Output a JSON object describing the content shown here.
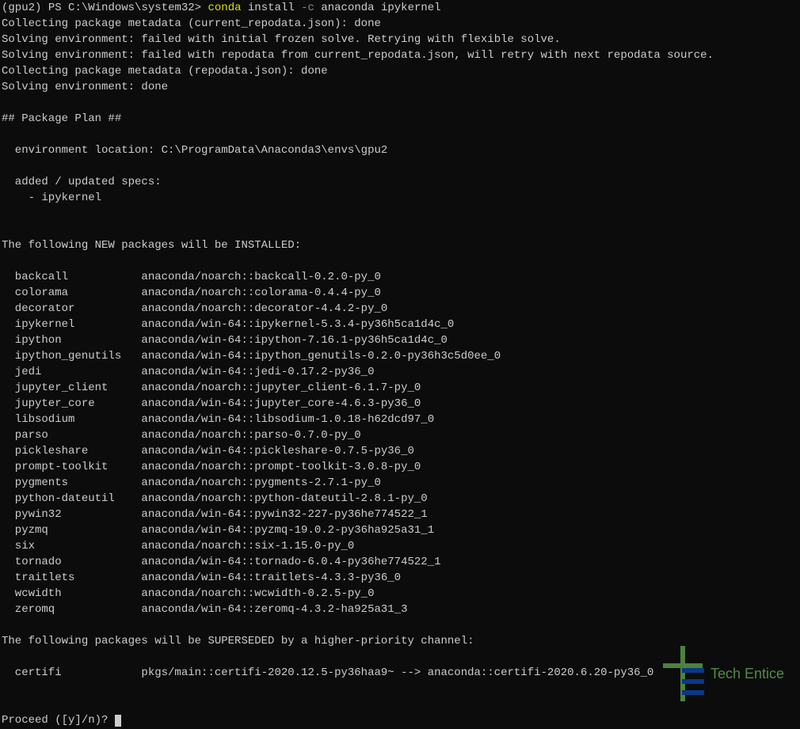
{
  "prompt": {
    "env": "(gpu2)",
    "ps": "PS",
    "path": "C:\\Windows\\system32>",
    "cmd_main": "conda",
    "cmd_install": "install",
    "flag": "-c",
    "arg1": "anaconda",
    "arg2": "ipykernel"
  },
  "lines": {
    "l1": "Collecting package metadata (current_repodata.json): done",
    "l2": "Solving environment: failed with initial frozen solve. Retrying with flexible solve.",
    "l3": "Solving environment: failed with repodata from current_repodata.json, will retry with next repodata source.",
    "l4": "Collecting package metadata (repodata.json): done",
    "l5": "Solving environment: done",
    "plan_header": "## Package Plan ##",
    "env_loc": "  environment location: C:\\ProgramData\\Anaconda3\\envs\\gpu2",
    "added_specs": "  added / updated specs:",
    "spec1": "    - ipykernel",
    "new_header": "The following NEW packages will be INSTALLED:",
    "super_header": "The following packages will be SUPERSEDED by a higher-priority channel:",
    "proceed": "Proceed ([y]/n)? "
  },
  "packages": [
    {
      "name": "backcall",
      "spec": "anaconda/noarch::backcall-0.2.0-py_0"
    },
    {
      "name": "colorama",
      "spec": "anaconda/noarch::colorama-0.4.4-py_0"
    },
    {
      "name": "decorator",
      "spec": "anaconda/noarch::decorator-4.4.2-py_0"
    },
    {
      "name": "ipykernel",
      "spec": "anaconda/win-64::ipykernel-5.3.4-py36h5ca1d4c_0"
    },
    {
      "name": "ipython",
      "spec": "anaconda/win-64::ipython-7.16.1-py36h5ca1d4c_0"
    },
    {
      "name": "ipython_genutils",
      "spec": "anaconda/win-64::ipython_genutils-0.2.0-py36h3c5d0ee_0"
    },
    {
      "name": "jedi",
      "spec": "anaconda/win-64::jedi-0.17.2-py36_0"
    },
    {
      "name": "jupyter_client",
      "spec": "anaconda/noarch::jupyter_client-6.1.7-py_0"
    },
    {
      "name": "jupyter_core",
      "spec": "anaconda/win-64::jupyter_core-4.6.3-py36_0"
    },
    {
      "name": "libsodium",
      "spec": "anaconda/win-64::libsodium-1.0.18-h62dcd97_0"
    },
    {
      "name": "parso",
      "spec": "anaconda/noarch::parso-0.7.0-py_0"
    },
    {
      "name": "pickleshare",
      "spec": "anaconda/win-64::pickleshare-0.7.5-py36_0"
    },
    {
      "name": "prompt-toolkit",
      "spec": "anaconda/noarch::prompt-toolkit-3.0.8-py_0"
    },
    {
      "name": "pygments",
      "spec": "anaconda/noarch::pygments-2.7.1-py_0"
    },
    {
      "name": "python-dateutil",
      "spec": "anaconda/noarch::python-dateutil-2.8.1-py_0"
    },
    {
      "name": "pywin32",
      "spec": "anaconda/win-64::pywin32-227-py36he774522_1"
    },
    {
      "name": "pyzmq",
      "spec": "anaconda/win-64::pyzmq-19.0.2-py36ha925a31_1"
    },
    {
      "name": "six",
      "spec": "anaconda/noarch::six-1.15.0-py_0"
    },
    {
      "name": "tornado",
      "spec": "anaconda/win-64::tornado-6.0.4-py36he774522_1"
    },
    {
      "name": "traitlets",
      "spec": "anaconda/win-64::traitlets-4.3.3-py36_0"
    },
    {
      "name": "wcwidth",
      "spec": "anaconda/noarch::wcwidth-0.2.5-py_0"
    },
    {
      "name": "zeromq",
      "spec": "anaconda/win-64::zeromq-4.3.2-ha925a31_3"
    }
  ],
  "superseded": [
    {
      "name": "certifi",
      "spec": "pkgs/main::certifi-2020.12.5-py36haa9~ --> anaconda::certifi-2020.6.20-py36_0"
    }
  ],
  "watermark": {
    "text": "Tech Entice"
  }
}
